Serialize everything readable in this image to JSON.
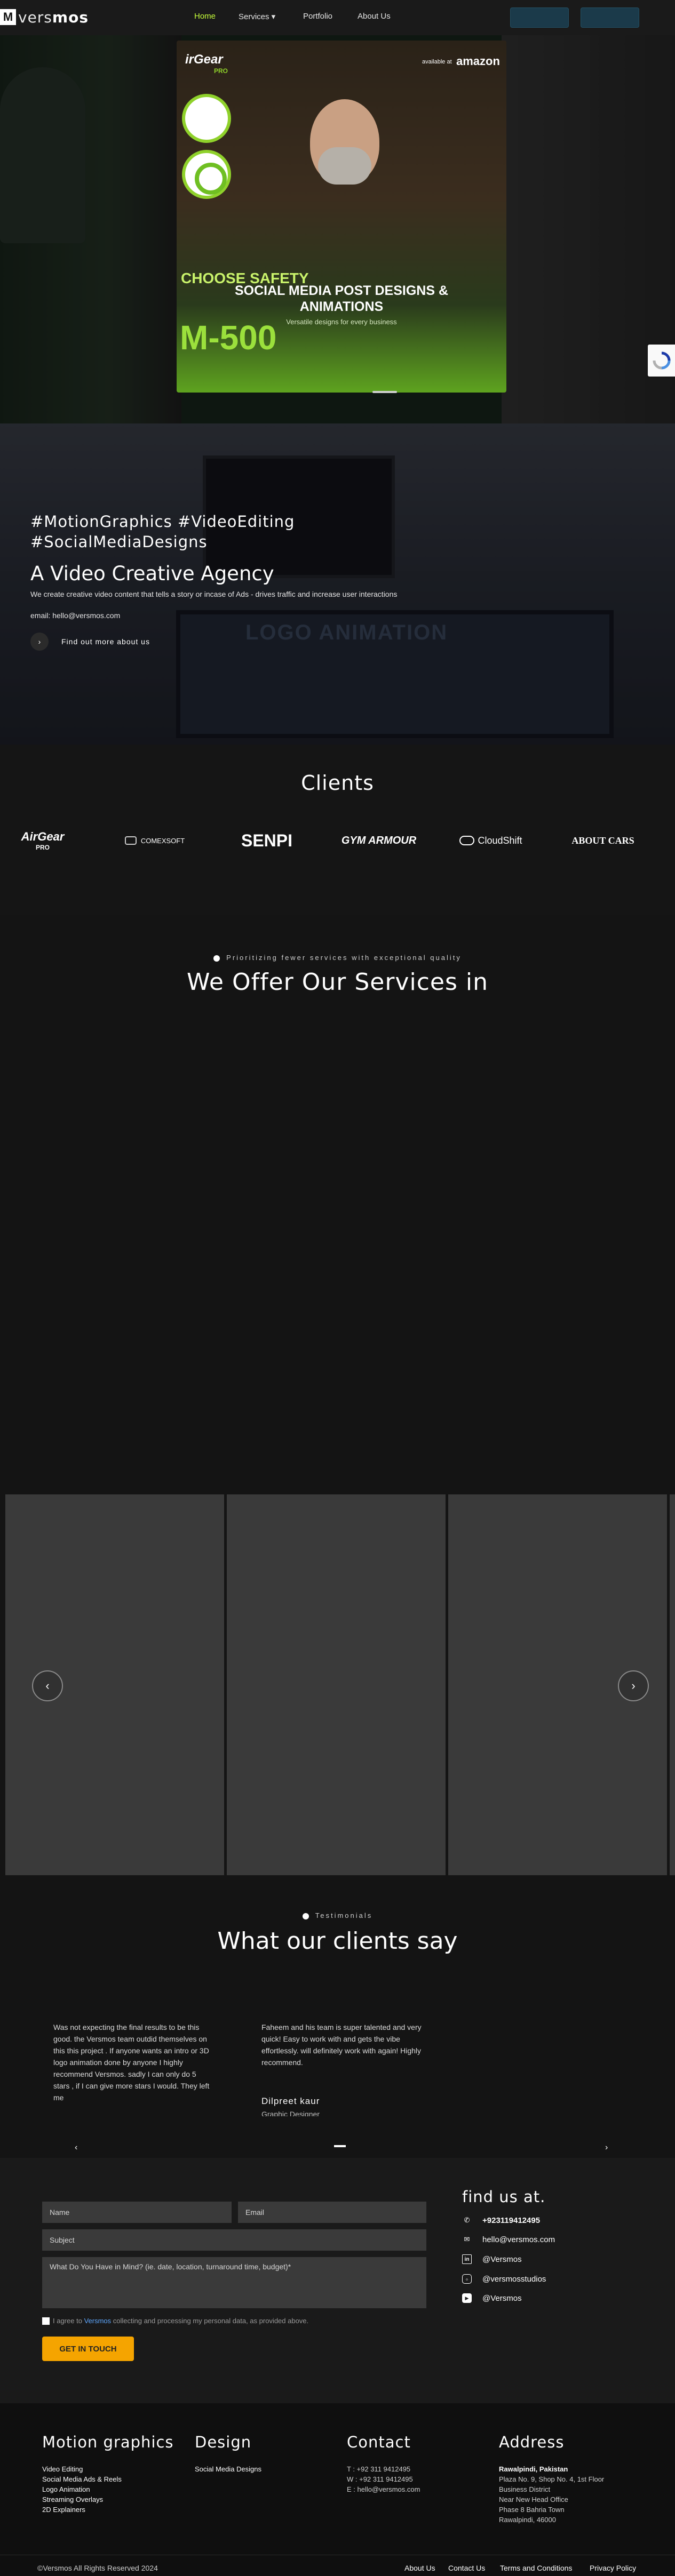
{
  "nav": {
    "logo_mark": "M",
    "logo_text_a": "vers",
    "logo_text_b": "mos",
    "items": [
      {
        "label": "Home"
      },
      {
        "label": "Services ▾"
      },
      {
        "label": "Portfolio"
      },
      {
        "label": "About Us"
      }
    ]
  },
  "hero": {
    "brand": "irGear",
    "brand_pro": "PRO",
    "available": "available at",
    "amazon": "amazon",
    "choose": "CHOOSE SAFETY",
    "model": "M-500",
    "title_line1": "SOCIAL MEDIA POST DESIGNS &",
    "title_line2": "ANIMATIONS",
    "subtitle": "Versatile designs for every business"
  },
  "agency": {
    "hashtag_line1": "#MotionGraphics #VideoEditing",
    "hashtag_line2": "#SocialMediaDesigns",
    "title": "A Video Creative Agency",
    "description": "We create creative video content that tells a story or incase of Ads - drives traffic and increase user interactions",
    "email": "email: hello@versmos.com",
    "cta": "Find out more about us",
    "screen_text": "LOGO ANIMATION"
  },
  "clients": {
    "title": "Clients",
    "logos": [
      {
        "name": "AirGear PRO",
        "text": "AirGear",
        "sub": "PRO"
      },
      {
        "name": "Comexsoft",
        "text": "COMEXSOFT"
      },
      {
        "name": "SENPI",
        "text": "SENPI"
      },
      {
        "name": "Gym Armour",
        "text": "GYM ARMOUR"
      },
      {
        "name": "CloudShift",
        "text": "CloudShift"
      },
      {
        "name": "About Cars",
        "text": "ABOUT CARS"
      }
    ]
  },
  "services": {
    "kicker": "Prioritizing fewer services with exceptional quality",
    "title": "We Offer Our Services in"
  },
  "testimonials": {
    "kicker": "Testimonials",
    "title": "What our clients say",
    "items": [
      {
        "quote": "Was not expecting the final results to be this good. the Versmos team outdid themselves on this this project . If anyone wants an intro or 3D logo animation done by anyone I highly recommend Versmos. sadly I can only do 5 stars , if I can give more stars I would. They left me"
      },
      {
        "quote": "Faheem and his team is super talented and very quick! Easy to work with and gets the vibe effortlessly. will definitely work with again! Highly recommend.",
        "name": "Dilpreet kaur",
        "role": "Graphic Designer"
      }
    ]
  },
  "contact": {
    "name_placeholder": "Name",
    "email_placeholder": "Email",
    "subject_placeholder": "Subject",
    "message_placeholder": "What Do You Have in Mind? (ie. date, location, turnaround time, budget)*",
    "consent_a": "I agree to",
    "consent_brand": "Versmos",
    "consent_b": "collecting and processing my personal data, as provided above.",
    "submit": "GET IN TOUCH",
    "find_title": "find us at.",
    "phone": "+923119412495",
    "email": "hello@versmos.com",
    "linkedin": "@Versmos",
    "instagram": "@versmosstudios",
    "youtube": "@Versmos"
  },
  "footer": {
    "col1_title": "Motion graphics",
    "col1_links": [
      "Video Editing",
      "Social Media Ads & Reels",
      "Logo Animation",
      "Streaming Overlays",
      "2D Explainers"
    ],
    "col2_title": "Design",
    "col2_links": [
      "Social Media Designs"
    ],
    "col3_title": "Contact",
    "contact_t": "T : +92 311 9412495",
    "contact_w": "W : +92 311 9412495",
    "contact_e": "E : hello@versmos.com",
    "col4_title": "Address",
    "address_city": "Rawalpindi, Pakistan",
    "address_lines": [
      "Plaza No. 9, Shop No. 4, 1st Floor",
      "Business District",
      "Near New Head Office",
      "Phase 8 Bahria Town",
      "Rawalpindi, 46000"
    ],
    "copyright": "©Versmos All Rights Reserved 2024",
    "bottom_links": [
      "About Us",
      "Contact Us",
      "Terms and Conditions",
      "Privacy Policy"
    ]
  },
  "colors": {
    "accent": "#c7ff3a",
    "button": "#f5a400",
    "link": "#5fa8ff"
  }
}
